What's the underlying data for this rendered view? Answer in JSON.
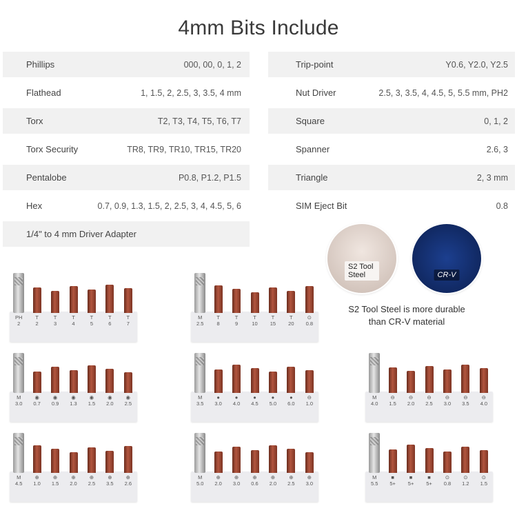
{
  "title": "4mm Bits Include",
  "left_rows": [
    {
      "name": "Phillips",
      "value": "000, 00, 0, 1, 2"
    },
    {
      "name": "Flathead",
      "value": "1, 1.5, 2, 2.5, 3, 3.5, 4 mm"
    },
    {
      "name": "Torx",
      "value": "T2, T3, T4, T5, T6, T7"
    },
    {
      "name": "Torx Security",
      "value": "TR8, TR9, TR10, TR15, TR20"
    },
    {
      "name": "Pentalobe",
      "value": "P0.8, P1.2, P1.5"
    },
    {
      "name": "Hex",
      "value": "0.7, 0.9, 1.3, 1.5, 2, 2.5, 3, 4, 4.5, 5, 6"
    },
    {
      "name": "1/4\" to 4 mm Driver Adapter",
      "value": ""
    }
  ],
  "right_rows": [
    {
      "name": "Trip-point",
      "value": "Y0.6, Y2.0, Y2.5"
    },
    {
      "name": "Nut Driver",
      "value": "2.5, 3, 3.5, 4, 4.5, 5, 5.5 mm, PH2"
    },
    {
      "name": "Square",
      "value": "0, 1, 2"
    },
    {
      "name": "Spanner",
      "value": "2.6, 3"
    },
    {
      "name": "Triangle",
      "value": "2, 3 mm"
    },
    {
      "name": "SIM Eject Bit",
      "value": "0.8"
    }
  ],
  "badges": {
    "s2": "S2 Tool Steel",
    "crv": "CR-V"
  },
  "caption_line1": "S2 Tool Steel is more durable",
  "caption_line2": "than CR-V material",
  "strips": [
    {
      "labels": [
        "PH\n2",
        "T\n2",
        "T\n3",
        "T\n4",
        "T\n5",
        "T\n6",
        "T\n7"
      ]
    },
    {
      "labels": [
        "M\n2.5",
        "T\n8",
        "T\n9",
        "T\n10",
        "T\n15",
        "T\n20",
        "⊙\n0.8"
      ]
    },
    {
      "labels": [
        "M\n3.0",
        "◉\n0.7",
        "◉\n0.9",
        "◉\n1.3",
        "◉\n1.5",
        "◉\n2.0",
        "◉\n2.5"
      ]
    },
    {
      "labels": [
        "M\n3.5",
        "●\n3.0",
        "●\n4.0",
        "●\n4.5",
        "●\n5.0",
        "●\n6.0",
        "⊖\n1.0"
      ]
    },
    {
      "labels": [
        "M\n4.0",
        "⊖\n1.5",
        "⊖\n2.0",
        "⊖\n2.5",
        "⊖\n3.0",
        "⊖\n3.5",
        "⊖\n4.0"
      ]
    },
    {
      "labels": [
        "M\n4.5",
        "⊕\n1.0",
        "⊕\n1.5",
        "⊕\n2.0",
        "⊕\n2.5",
        "⊕\n3.5",
        "⊕\n2.6"
      ]
    },
    {
      "labels": [
        "M\n5.0",
        "⊕\n2.0",
        "⊕\n3.0",
        "⊕\n0.6",
        "⊕\n2.0",
        "⊕\n2.5",
        "⊕\n3.0"
      ]
    },
    {
      "labels": [
        "M\n5.5",
        "■\n5+",
        "■\n5+",
        "■\n5+",
        "⊙\n0.8",
        "⊙\n1.2",
        "⊙\n1.5"
      ]
    }
  ]
}
